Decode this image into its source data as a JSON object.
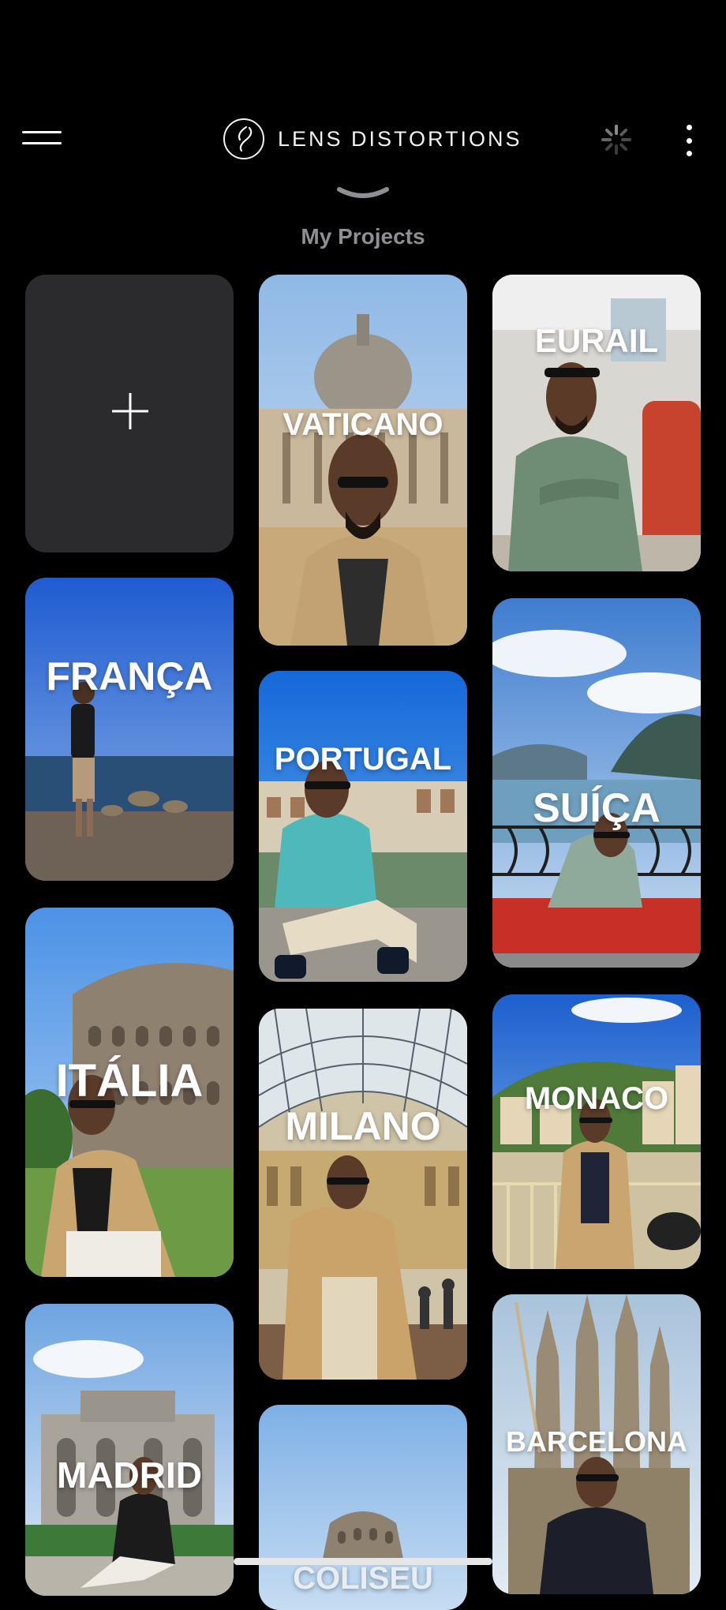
{
  "app": {
    "name": "LENS DISTORTIONS"
  },
  "section": {
    "title": "My Projects"
  },
  "colors": {
    "background": "#000000",
    "card_new": "#2b2b2d",
    "section_title": "#8e8e93"
  },
  "icons": {
    "menu": "hamburger-menu-icon",
    "logo": "lens-logo-icon",
    "sync": "activity-spinner-icon",
    "more": "more-vertical-icon",
    "chevron": "chevron-down-icon",
    "plus": "plus-icon"
  },
  "projects": [
    {
      "label": "VATICANO"
    },
    {
      "label": "EURAIL"
    },
    {
      "label": "FRANÇA"
    },
    {
      "label": "PORTUGAL"
    },
    {
      "label": "SUÍÇA"
    },
    {
      "label": "ITÁLIA"
    },
    {
      "label": "MILANO"
    },
    {
      "label": "MONACO"
    },
    {
      "label": "MADRID"
    },
    {
      "label": "COLISEU"
    },
    {
      "label": "BARCELONA"
    }
  ]
}
